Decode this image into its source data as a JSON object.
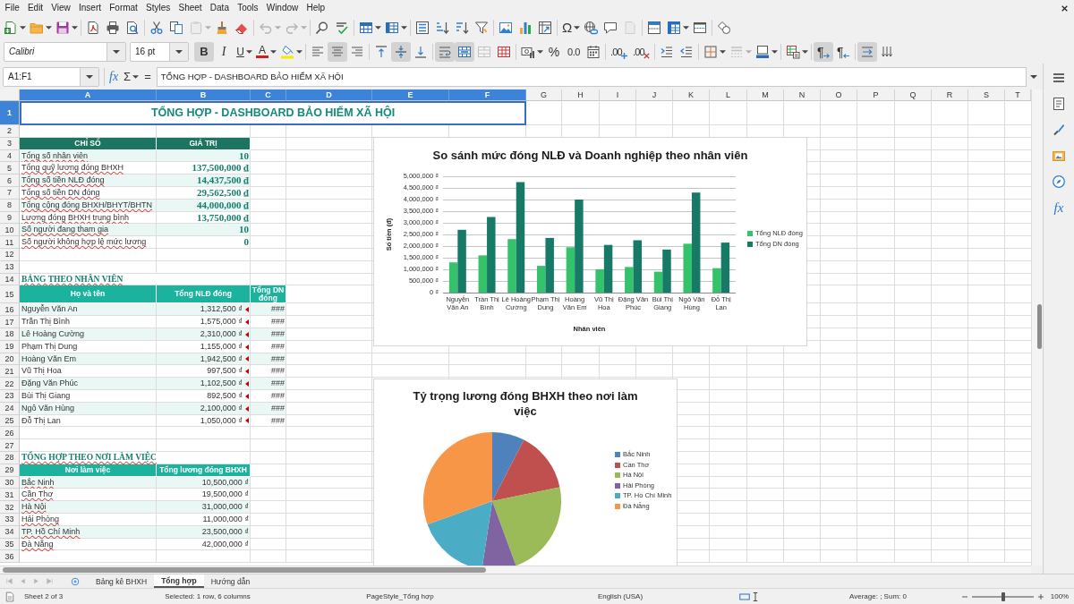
{
  "menu": [
    "File",
    "Edit",
    "View",
    "Insert",
    "Format",
    "Styles",
    "Sheet",
    "Data",
    "Tools",
    "Window",
    "Help"
  ],
  "standard_toolbar": [
    [
      {
        "kind": "split",
        "pressed": false,
        "disabled": false
      },
      {
        "kind": "split",
        "pressed": false,
        "disabled": false
      },
      {
        "kind": "split",
        "pressed": false,
        "disabled": false
      }
    ],
    [
      {
        "kind": "button",
        "pressed": false,
        "disabled": false
      },
      {
        "kind": "button",
        "pressed": false,
        "disabled": false
      },
      {
        "kind": "button",
        "pressed": false,
        "disabled": false
      }
    ],
    [
      {
        "kind": "button",
        "pressed": false,
        "disabled": false
      },
      {
        "kind": "button",
        "pressed": false,
        "disabled": false
      },
      {
        "kind": "split",
        "pressed": false,
        "disabled": true
      },
      {
        "kind": "button",
        "pressed": false,
        "disabled": false
      },
      {
        "kind": "button",
        "pressed": false,
        "disabled": false
      }
    ],
    [
      {
        "kind": "split",
        "pressed": false,
        "disabled": true
      },
      {
        "kind": "split",
        "pressed": false,
        "disabled": true
      }
    ],
    [
      {
        "kind": "button",
        "pressed": false,
        "disabled": false
      },
      {
        "kind": "button",
        "pressed": false,
        "disabled": false
      }
    ],
    [
      {
        "kind": "split",
        "pressed": false,
        "disabled": false
      },
      {
        "kind": "split",
        "pressed": false,
        "disabled": false
      }
    ],
    [
      {
        "kind": "button",
        "pressed": false,
        "disabled": false
      },
      {
        "kind": "button",
        "pressed": false,
        "disabled": false
      },
      {
        "kind": "button",
        "pressed": false,
        "disabled": false
      },
      {
        "kind": "button",
        "pressed": false,
        "disabled": false
      }
    ],
    [
      {
        "kind": "button",
        "pressed": false,
        "disabled": false
      },
      {
        "kind": "button",
        "pressed": false,
        "disabled": false
      },
      {
        "kind": "button",
        "pressed": false,
        "disabled": false
      }
    ],
    [
      {
        "kind": "split",
        "label": "Ω",
        "pressed": false,
        "disabled": false
      },
      {
        "kind": "button",
        "pressed": false,
        "disabled": false
      },
      {
        "kind": "button",
        "pressed": false,
        "disabled": false
      },
      {
        "kind": "button",
        "pressed": false,
        "disabled": true
      }
    ],
    [
      {
        "kind": "button",
        "pressed": false,
        "disabled": false
      },
      {
        "kind": "split",
        "pressed": false,
        "disabled": false
      },
      {
        "kind": "button",
        "pressed": false,
        "disabled": false
      }
    ],
    [
      {
        "kind": "button",
        "pressed": false,
        "disabled": false
      }
    ]
  ],
  "formatting_toolbar": {
    "font_name": "Calibri",
    "font_size": "16 pt",
    "groups": [
      [
        {
          "kind": "button",
          "label": "B",
          "pressed": true,
          "disabled": false
        },
        {
          "kind": "button",
          "label": "I",
          "pressed": false,
          "disabled": false
        },
        {
          "kind": "split",
          "label": "U",
          "pressed": false,
          "disabled": false
        },
        {
          "kind": "split",
          "label": "A",
          "pressed": false,
          "disabled": false
        },
        {
          "kind": "split",
          "pressed": false,
          "disabled": false
        }
      ],
      [
        {
          "kind": "button",
          "pressed": false,
          "disabled": false
        },
        {
          "kind": "button",
          "pressed": true,
          "disabled": false
        },
        {
          "kind": "button",
          "pressed": false,
          "disabled": false
        }
      ],
      [
        {
          "kind": "button",
          "pressed": false,
          "disabled": false
        },
        {
          "kind": "button",
          "pressed": true,
          "disabled": false
        },
        {
          "kind": "button",
          "pressed": false,
          "disabled": false
        }
      ],
      [
        {
          "kind": "button",
          "pressed": true,
          "disabled": false
        },
        {
          "kind": "button",
          "pressed": true,
          "disabled": false
        },
        {
          "kind": "button",
          "pressed": false,
          "disabled": true
        },
        {
          "kind": "button",
          "pressed": false,
          "disabled": false
        }
      ],
      [
        {
          "kind": "split",
          "pressed": false,
          "disabled": false
        },
        {
          "kind": "button",
          "label": "%",
          "pressed": false,
          "disabled": false
        },
        {
          "kind": "button",
          "label": "0.0",
          "pressed": false,
          "disabled": false
        },
        {
          "kind": "button",
          "pressed": false,
          "disabled": false
        }
      ],
      [
        {
          "kind": "button",
          "label": ".00",
          "pressed": false,
          "disabled": false
        },
        {
          "kind": "button",
          "label": ".00",
          "pressed": false,
          "disabled": false
        }
      ],
      [
        {
          "kind": "button",
          "pressed": false,
          "disabled": false
        },
        {
          "kind": "button",
          "pressed": false,
          "disabled": false
        }
      ],
      [
        {
          "kind": "split",
          "pressed": false,
          "disabled": false
        },
        {
          "kind": "split",
          "pressed": false,
          "disabled": true
        },
        {
          "kind": "split",
          "pressed": false,
          "disabled": false
        }
      ],
      [
        {
          "kind": "split",
          "pressed": false,
          "disabled": false
        }
      ],
      [
        {
          "kind": "button",
          "label": "¶",
          "pressed": true,
          "disabled": false
        },
        {
          "kind": "button",
          "label": "¶",
          "pressed": false,
          "disabled": false
        }
      ],
      [
        {
          "kind": "button",
          "pressed": true,
          "disabled": false
        },
        {
          "kind": "button",
          "pressed": false,
          "disabled": false
        }
      ]
    ]
  },
  "formula_bar": {
    "name_box": "A1:F1",
    "buttons": [
      {
        "kind": "wizard",
        "label": "fx"
      },
      {
        "kind": "menu",
        "label": "Σ"
      },
      {
        "kind": "plain",
        "label": "="
      }
    ],
    "content": "TỔNG HỢP - DASHBOARD BẢO HIỂM XÃ HỘI"
  },
  "sidebar": {
    "function_label": "fx"
  },
  "sheet": {
    "columns": [
      {
        "label": "A",
        "selected": true
      },
      {
        "label": "B",
        "selected": true
      },
      {
        "label": "C",
        "selected": true
      },
      {
        "label": "D",
        "selected": true
      },
      {
        "label": "E",
        "selected": true
      },
      {
        "label": "F",
        "selected": true
      },
      {
        "label": "G",
        "selected": false
      },
      {
        "label": "H",
        "selected": false
      },
      {
        "label": "I",
        "selected": false
      },
      {
        "label": "J",
        "selected": false
      },
      {
        "label": "K",
        "selected": false
      },
      {
        "label": "L",
        "selected": false
      },
      {
        "label": "M",
        "selected": false
      },
      {
        "label": "N",
        "selected": false
      },
      {
        "label": "O",
        "selected": false
      },
      {
        "label": "P",
        "selected": false
      },
      {
        "label": "Q",
        "selected": false
      },
      {
        "label": "R",
        "selected": false
      },
      {
        "label": "S",
        "selected": false
      },
      {
        "label": "T",
        "selected": false
      }
    ],
    "rows": [
      {
        "label": "1",
        "selected": true
      },
      {
        "label": "2",
        "selected": false
      },
      {
        "label": "3",
        "selected": false
      },
      {
        "label": "4",
        "selected": false
      },
      {
        "label": "5",
        "selected": false
      },
      {
        "label": "6",
        "selected": false
      },
      {
        "label": "7",
        "selected": false
      },
      {
        "label": "8",
        "selected": false
      },
      {
        "label": "9",
        "selected": false
      },
      {
        "label": "10",
        "selected": false
      },
      {
        "label": "11",
        "selected": false
      },
      {
        "label": "12",
        "selected": false
      },
      {
        "label": "13",
        "selected": false
      },
      {
        "label": "14",
        "selected": false
      },
      {
        "label": "15",
        "selected": false
      },
      {
        "label": "16",
        "selected": false
      },
      {
        "label": "17",
        "selected": false
      },
      {
        "label": "18",
        "selected": false
      },
      {
        "label": "19",
        "selected": false
      },
      {
        "label": "20",
        "selected": false
      },
      {
        "label": "21",
        "selected": false
      },
      {
        "label": "22",
        "selected": false
      },
      {
        "label": "23",
        "selected": false
      },
      {
        "label": "24",
        "selected": false
      },
      {
        "label": "25",
        "selected": false
      },
      {
        "label": "26",
        "selected": false
      },
      {
        "label": "27",
        "selected": false
      },
      {
        "label": "28",
        "selected": false
      },
      {
        "label": "29",
        "selected": false
      },
      {
        "label": "30",
        "selected": false
      },
      {
        "label": "31",
        "selected": false
      },
      {
        "label": "32",
        "selected": false
      },
      {
        "label": "33",
        "selected": false
      },
      {
        "label": "34",
        "selected": false
      },
      {
        "label": "35",
        "selected": false
      },
      {
        "label": "36",
        "selected": false
      }
    ],
    "title": {
      "text": "TỔNG HỢP - DASHBOARD BẢO HIỂM XÃ HỘI",
      "selected": true
    },
    "summary_table": {
      "columns": [
        "CHỈ SỐ",
        "GIÁ TRỊ"
      ],
      "rows": [
        {
          "label": "Tổng số nhân viên",
          "value": "10",
          "spell_flagged": true
        },
        {
          "label": "Tổng quỹ lương đóng BHXH",
          "value": "137,500,000 ₫",
          "spell_flagged": true
        },
        {
          "label": "Tổng số tiền NLĐ đóng",
          "value": "14,437,500 ₫",
          "spell_flagged": true
        },
        {
          "label": "Tổng số tiền DN đóng",
          "value": "29,562,500 ₫",
          "spell_flagged": true
        },
        {
          "label": "Tổng cộng đóng BHXH/BHYT/BHTN",
          "value": "44,000,000 ₫",
          "spell_flagged": true
        },
        {
          "label": "Lương đóng BHXH trung bình",
          "value": "13,750,000 ₫",
          "spell_flagged": true
        },
        {
          "label": "Số người đang tham gia",
          "value": "10",
          "spell_flagged": true
        },
        {
          "label": "Số người không hợp lệ mức lương",
          "value": "0",
          "spell_flagged": true
        }
      ]
    },
    "employee_table": {
      "title": {
        "text": "BẢNG THEO NHÂN VIÊN",
        "spell_flagged": true
      },
      "columns": [
        "Họ và tên",
        "Tổng NLĐ đóng",
        "Tổng DN đóng"
      ],
      "rows": [
        {
          "name": "Nguyễn Văn An",
          "employee_contribution": "1,312,500 ₫",
          "employer_contribution": "###",
          "clipped": true
        },
        {
          "name": "Trần Thị Bình",
          "employee_contribution": "1,575,000 ₫",
          "employer_contribution": "###",
          "clipped": true
        },
        {
          "name": "Lê Hoàng Cường",
          "employee_contribution": "2,310,000 ₫",
          "employer_contribution": "###",
          "clipped": true
        },
        {
          "name": "Phạm Thị Dung",
          "employee_contribution": "1,155,000 ₫",
          "employer_contribution": "###",
          "clipped": true
        },
        {
          "name": "Hoàng Văn Em",
          "employee_contribution": "1,942,500 ₫",
          "employer_contribution": "###",
          "clipped": true
        },
        {
          "name": "Vũ Thị Hoa",
          "employee_contribution": "997,500 ₫",
          "employer_contribution": "###",
          "clipped": true
        },
        {
          "name": "Đặng Văn Phúc",
          "employee_contribution": "1,102,500 ₫",
          "employer_contribution": "###",
          "clipped": true
        },
        {
          "name": "Bùi Thị Giang",
          "employee_contribution": "892,500 ₫",
          "employer_contribution": "###",
          "clipped": true
        },
        {
          "name": "Ngô Văn Hùng",
          "employee_contribution": "2,100,000 ₫",
          "employer_contribution": "###",
          "clipped": true
        },
        {
          "name": "Đỗ Thị Lan",
          "employee_contribution": "1,050,000 ₫",
          "employer_contribution": "###",
          "clipped": true
        }
      ]
    },
    "workplace_table": {
      "title": {
        "text": "TỔNG HỢP THEO NƠI LÀM VIỆC",
        "spell_flagged": true
      },
      "columns": [
        "Nơi làm việc",
        "Tổng lương đóng BHXH"
      ],
      "rows": [
        {
          "place": "Bắc Ninh",
          "total": "10,500,000 ₫",
          "spell_flagged": true
        },
        {
          "place": "Cần Thơ",
          "total": "19,500,000 ₫",
          "spell_flagged": true
        },
        {
          "place": "Hà Nội",
          "total": "31,000,000 ₫",
          "spell_flagged": true
        },
        {
          "place": "Hải Phòng",
          "total": "11,000,000 ₫",
          "spell_flagged": true
        },
        {
          "place": "TP. Hồ Chí Minh",
          "total": "23,500,000 ₫",
          "spell_flagged": true
        },
        {
          "place": "Đà Nẵng",
          "total": "42,000,000 ₫",
          "spell_flagged": true
        }
      ]
    },
    "bar_chart": {
      "chart_data": {
        "type": "bar",
        "title": "So sánh mức đóng NLĐ và Doanh nghiệp theo nhân viên",
        "xlabel": "Nhân viên",
        "ylabel": "Số tiền (đ)",
        "categories": [
          "Nguyễn Văn An",
          "Trần Thị Bình",
          "Lê Hoàng Cường",
          "Phạm Thị Dung",
          "Hoàng Văn Em",
          "Vũ Thị Hoa",
          "Đặng Văn Phúc",
          "Bùi Thị Giang",
          "Ngô Văn Hùng",
          "Đỗ Thị Lan"
        ],
        "series": [
          {
            "name": "Tổng NLĐ đóng",
            "color": "#34c26b",
            "values": [
              1300000,
              1600000,
              2300000,
              1150000,
              1950000,
              1000000,
              1100000,
              900000,
              2100000,
              1050000
            ]
          },
          {
            "name": "Tổng DN đóng",
            "color": "#177a67",
            "values": [
              2700000,
              3250000,
              4750000,
              2350000,
              4000000,
              2050000,
              2250000,
              1850000,
              4300000,
              2150000
            ]
          }
        ],
        "ylim": [
          0,
          5000000
        ],
        "yticks": [
          {
            "value": 0,
            "label": "0 ₫"
          },
          {
            "value": 500000,
            "label": "500,000 ₫"
          },
          {
            "value": 1000000,
            "label": "1,000,000 ₫"
          },
          {
            "value": 1500000,
            "label": "1,500,000 ₫"
          },
          {
            "value": 2000000,
            "label": "2,000,000 ₫"
          },
          {
            "value": 2500000,
            "label": "2,500,000 ₫"
          },
          {
            "value": 3000000,
            "label": "3,000,000 ₫"
          },
          {
            "value": 3500000,
            "label": "3,500,000 ₫"
          },
          {
            "value": 4000000,
            "label": "4,000,000 ₫"
          },
          {
            "value": 4500000,
            "label": "4,500,000 ₫"
          },
          {
            "value": 5000000,
            "label": "5,000,000 ₫"
          }
        ],
        "grid": true,
        "legend": "right"
      }
    },
    "pie_chart": {
      "chart_data": {
        "type": "pie",
        "title": "Tỷ trọng lương đóng BHXH theo nơi làm việc",
        "categories": [
          "Bắc Ninh",
          "Cần Thơ",
          "Hà Nội",
          "Hải Phòng",
          "TP. Hồ Chí Minh",
          "Đà Nẵng"
        ],
        "values": [
          7.6,
          14.2,
          22.6,
          8.0,
          17.1,
          30.5
        ],
        "colors": [
          "#4f81bd",
          "#c0504d",
          "#9bbb59",
          "#8064a2",
          "#4bacc6",
          "#f79646"
        ],
        "legend": "right"
      }
    }
  },
  "sheet_tabs": [
    {
      "label": "Bảng kê BHXH",
      "selected": false
    },
    {
      "label": "Tổng hợp",
      "selected": true
    },
    {
      "label": "Hướng dẫn",
      "selected": false
    }
  ],
  "status_bar": {
    "sheet_position": "Sheet 2 of 3",
    "selection": "Selected: 1 row, 6 columns",
    "page_style": "PageStyle_Tổng hợp",
    "language": "English (USA)",
    "statistics": "Average: ; Sum: 0",
    "zoom_slider": {
      "level": 0.5
    },
    "zoom": "100%"
  }
}
